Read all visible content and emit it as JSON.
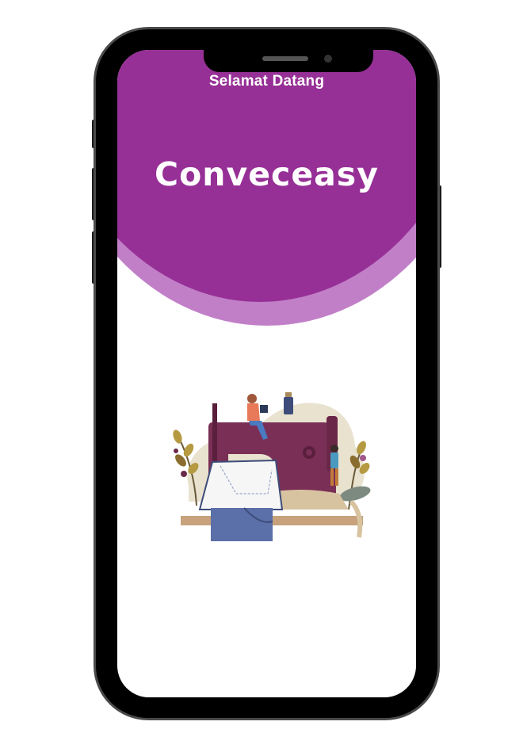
{
  "screen": {
    "welcome_text": "Selamat Datang",
    "brand_name": "Conveceasy"
  },
  "illustration": {
    "icon": "sewing-machine-illustration"
  },
  "colors": {
    "primary": "#963096",
    "primary_light": "#c17fc8",
    "background": "#ffffff",
    "phone_frame": "#000000"
  }
}
